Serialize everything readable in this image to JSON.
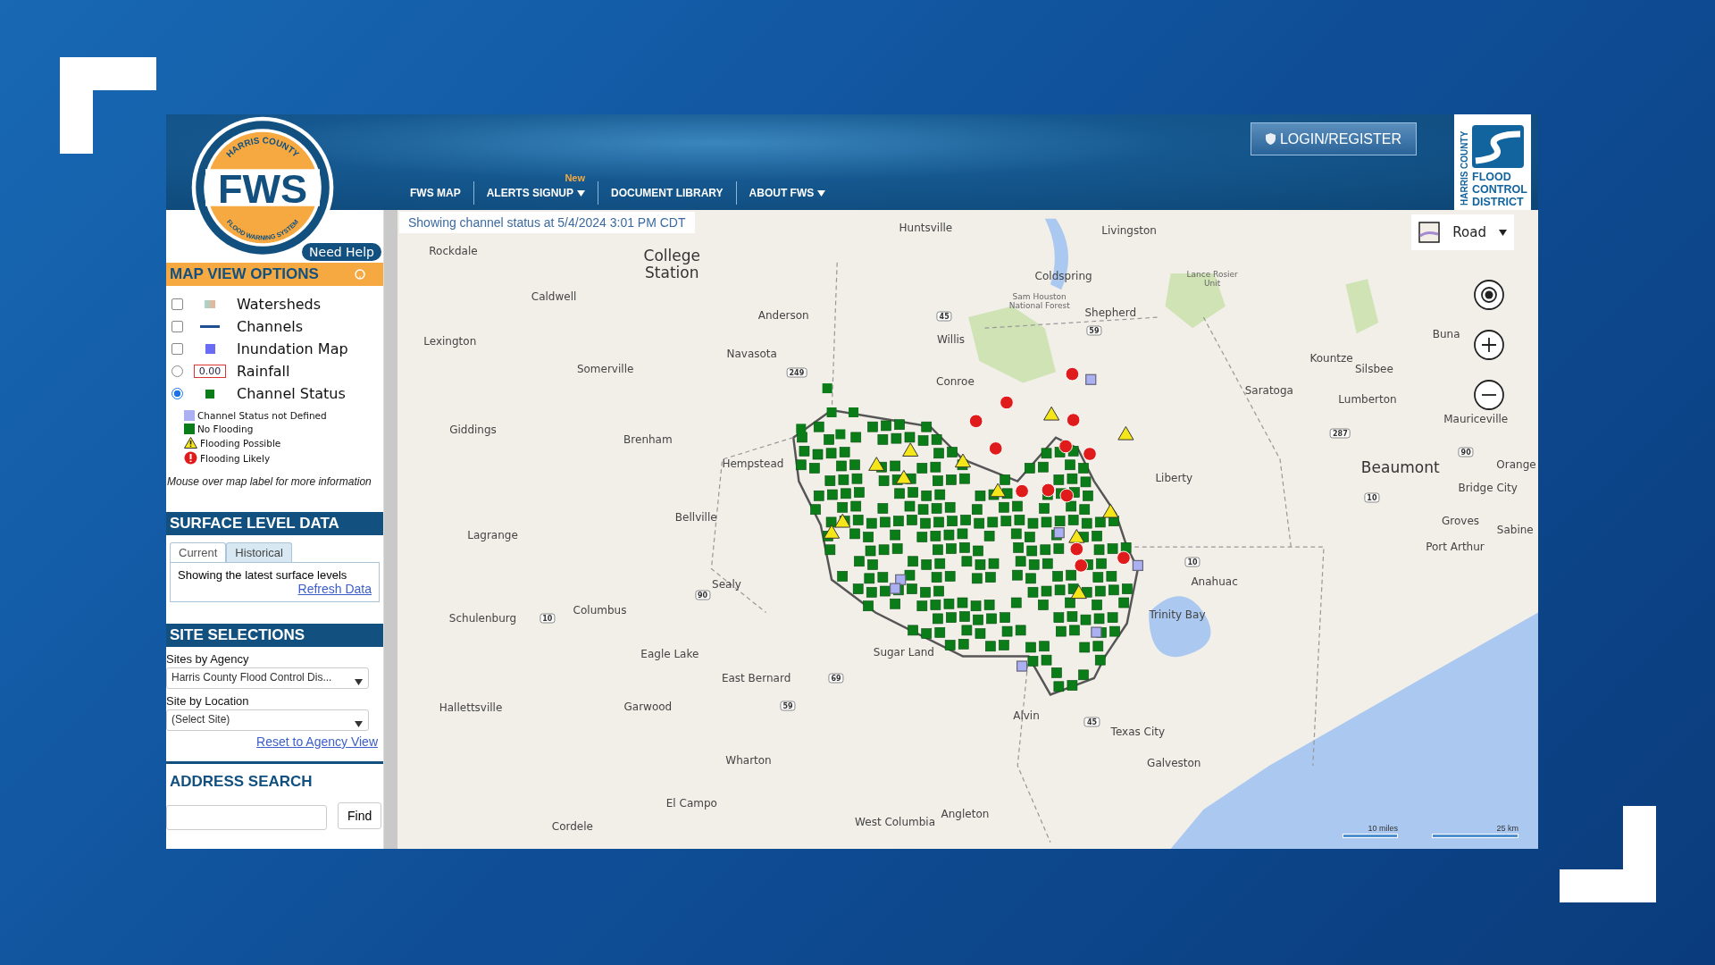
{
  "header": {
    "logo": {
      "top_text": "HARRIS COUNTY",
      "title": "FWS",
      "bottom_text": "FLOOD WARNING SYSTEM"
    },
    "nav": [
      {
        "label": "FWS MAP",
        "dropdown": false
      },
      {
        "label": "ALERTS SIGNUP",
        "dropdown": true,
        "badge": "New"
      },
      {
        "label": "DOCUMENT LIBRARY",
        "dropdown": false
      },
      {
        "label": "ABOUT FWS",
        "dropdown": true
      }
    ],
    "login_button": "LOGIN/REGISTER",
    "district_logo": {
      "side_text": "HARRIS COUNTY",
      "lines": [
        "FLOOD",
        "CONTROL",
        "DISTRICT"
      ]
    }
  },
  "sidebar": {
    "help_button": "Need Help",
    "map_view_options": {
      "title": "MAP VIEW OPTIONS",
      "layers": [
        {
          "kind": "swatch",
          "label": "Watersheds",
          "checked": false
        },
        {
          "kind": "line",
          "label": "Channels",
          "checked": false
        },
        {
          "kind": "square",
          "label": "Inundation Map",
          "checked": false
        },
        {
          "kind": "value",
          "label": "Rainfall",
          "symbol_text": "0.00",
          "selected": false
        },
        {
          "kind": "status",
          "label": "Channel Status",
          "selected": true
        }
      ],
      "legend": [
        {
          "kind": "square",
          "label": "Channel Status not Defined",
          "color": "#aab0f2"
        },
        {
          "kind": "square",
          "label": "No Flooding",
          "color": "#0b7d18"
        },
        {
          "kind": "warning",
          "label": "Flooding Possible"
        },
        {
          "kind": "alert",
          "label": "Flooding Likely"
        }
      ],
      "note": "Mouse over map label for more information"
    },
    "surface_level": {
      "title": "SURFACE LEVEL DATA",
      "tabs": [
        {
          "label": "Current",
          "selected": true
        },
        {
          "label": "Historical",
          "selected": false
        }
      ],
      "message": "Showing the latest surface levels",
      "link": "Refresh Data"
    },
    "site_selections": {
      "title": "SITE SELECTIONS",
      "fields": [
        {
          "label": "Sites by Agency",
          "value": "Harris County Flood Control Dis..."
        },
        {
          "label": "Site by Location",
          "value": "(Select Site)"
        }
      ],
      "link": "Reset to Agency View"
    },
    "address_search": {
      "title": "ADDRESS SEARCH",
      "button": "Find"
    }
  },
  "map": {
    "status": "Showing channel status at 5/4/2024 3:01 PM CDT",
    "map_type": "Road",
    "labels": [
      "Huntsville",
      "Livingston",
      "Rockdale",
      "College Station",
      "Coldspring",
      "Sam Houston National Forest",
      "Lance Rosier Unit",
      "Caldwell",
      "Anderson",
      "Shepherd",
      "Buna",
      "Lexington",
      "Willis",
      "Navasota",
      "Kountze",
      "Silsbee",
      "Somerville",
      "Conroe",
      "Saratoga",
      "Lumberton",
      "Mauriceville",
      "Giddings",
      "Brenham",
      "Hempstead",
      "Liberty",
      "Beaumont",
      "Orange",
      "Bridge City",
      "Bellville",
      "Lagrange",
      "Groves",
      "Sabine",
      "Port Arthur",
      "Sealy",
      "Anahuac",
      "Columbus",
      "Schulenburg",
      "Trinity Bay",
      "Eagle Lake",
      "Sugar Land",
      "East Bernard",
      "Hallettsville",
      "Garwood",
      "Alvin",
      "Texas City",
      "Galveston",
      "Wharton",
      "El Campo",
      "West Columbia",
      "Angleton",
      "Cordele"
    ],
    "highway_shields": [
      "45",
      "59",
      "249",
      "287",
      "90",
      "10",
      "10",
      "90",
      "10",
      "69",
      "59",
      "45"
    ],
    "scale": [
      "10 miles",
      "25 km"
    ]
  }
}
